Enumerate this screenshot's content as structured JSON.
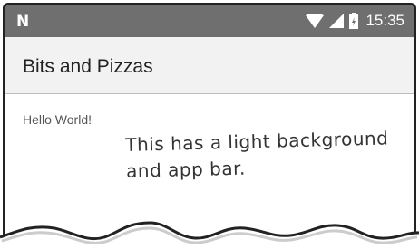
{
  "status_bar": {
    "left_icon": "notification-n-icon",
    "wifi_icon": "wifi-icon",
    "signal_icon": "cell-signal-icon",
    "battery_icon": "battery-icon",
    "time": "15:35"
  },
  "app_bar": {
    "title": "Bits and Pizzas"
  },
  "content": {
    "hello_text": "Hello World!"
  },
  "annotation": {
    "line1": "This has a light background",
    "line2": "and app bar."
  },
  "colors": {
    "status_bar": "#6f6f6f",
    "app_bar": "#f2f2f2",
    "background": "#ffffff"
  }
}
